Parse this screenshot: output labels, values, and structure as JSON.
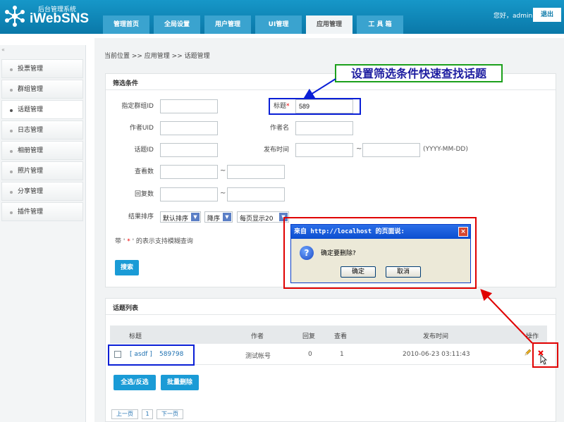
{
  "header": {
    "logo_subtitle": "后台管理系统",
    "logo_name": "iWebSNS",
    "greeting": "您好，admin",
    "logout_label": "退出",
    "tabs": [
      {
        "label": "管理首页"
      },
      {
        "label": "全局设置"
      },
      {
        "label": "用户管理"
      },
      {
        "label": "UI管理"
      },
      {
        "label": "应用管理"
      },
      {
        "label": "工 具 箱"
      }
    ],
    "active_tab": "应用管理"
  },
  "sidebar": {
    "collapse_label": "«",
    "items": [
      {
        "label": "投票管理"
      },
      {
        "label": "群组管理"
      },
      {
        "label": "话题管理"
      },
      {
        "label": "日志管理"
      },
      {
        "label": "相册管理"
      },
      {
        "label": "照片管理"
      },
      {
        "label": "分享管理"
      },
      {
        "label": "插件管理"
      }
    ],
    "active_item": "话题管理"
  },
  "breadcrumb": "当前位置 >> 应用管理 >> 话题管理",
  "filter": {
    "title": "筛选条件",
    "group_id_label": "指定群组ID",
    "group_id_value": "",
    "title_label": "标题",
    "title_value": "589",
    "author_uid_label": "作者UID",
    "author_uid_value": "",
    "author_name_label": "作者名",
    "author_name_value": "",
    "topic_id_label": "话题ID",
    "topic_id_value": "",
    "publish_time_label": "发布时间",
    "publish_time_from": "",
    "publish_time_to": "",
    "date_format": "(YYYY-MM-DD)",
    "views_label": "查看数",
    "replies_label": "回复数",
    "tilde": "~",
    "sort_label": "结果排序",
    "sort_field": "默认排序",
    "sort_order": "降序",
    "page_size": "每页显示20",
    "fuzzy_note_prefix": "带 ' ",
    "fuzzy_note_star": "*",
    "fuzzy_note_suffix": " ' 的表示支持模糊查询",
    "search_label": "搜索"
  },
  "list": {
    "title": "话题列表",
    "columns": {
      "title": "标题",
      "author": "作者",
      "replies": "回复",
      "views": "查看",
      "time": "发布时间",
      "ops": "操作"
    },
    "rows": [
      {
        "group": "[ asdf ]",
        "topic": "589798",
        "author": "测试帐号",
        "replies": "0",
        "views": "1",
        "time": "2010-06-23 03:11:43"
      }
    ],
    "select_all_label": "全选/反选",
    "batch_delete_label": "批量删除"
  },
  "pager": {
    "prev_label": "上一页",
    "page": "1",
    "next_label": "下一页"
  },
  "annotation": {
    "label": "设置筛选条件快速查找话题",
    "colors": {
      "blue": "#0a1fd6",
      "red": "#e00000",
      "green": "#1ca01c"
    }
  },
  "dialog": {
    "title": "来自 http://localhost 的页面说:",
    "message": "确定要删除?",
    "ok_label": "确定",
    "cancel_label": "取消",
    "close_label": "×",
    "icon_label": "?"
  },
  "icons": {
    "edit": "pencil-icon",
    "delete": "delete-x-icon",
    "cursor": "mouse-cursor-icon"
  }
}
